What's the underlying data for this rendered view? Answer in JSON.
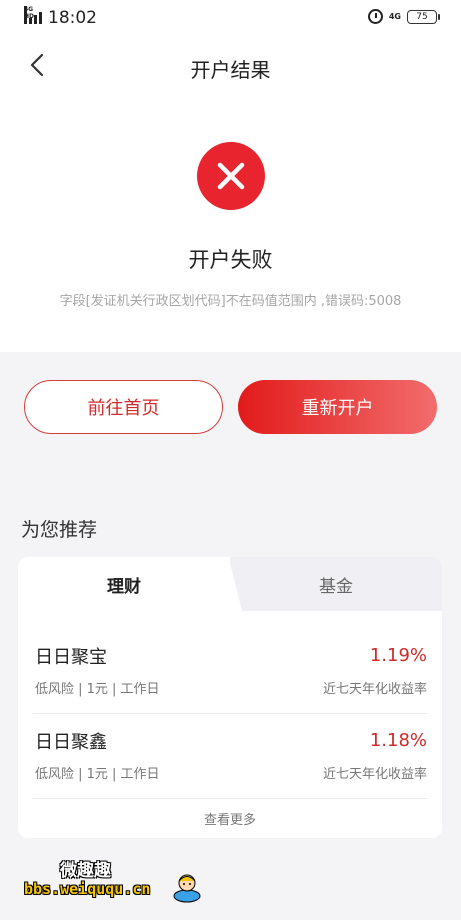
{
  "status_bar": {
    "network_tag": "4G HD",
    "time": "18:02",
    "network_small": "4G",
    "battery": "75"
  },
  "nav": {
    "title": "开户结果"
  },
  "result": {
    "title": "开户失败",
    "error_message": "字段[发证机关行政区划代码]不在码值范围内 ,错误码:5008"
  },
  "actions": {
    "home_label": "前往首页",
    "reopen_label": "重新开户"
  },
  "recommend": {
    "section_title": "为您推荐",
    "tabs": [
      {
        "label": "理财",
        "active": true
      },
      {
        "label": "基金",
        "active": false
      }
    ],
    "items": [
      {
        "name": "日日聚宝",
        "rate": "1.19%",
        "tags": "低风险 | 1元 | 工作日",
        "rate_label": "近七天年化收益率"
      },
      {
        "name": "日日聚鑫",
        "rate": "1.18%",
        "tags": "低风险 | 1元 | 工作日",
        "rate_label": "近七天年化收益率"
      }
    ],
    "more_label": "查看更多"
  },
  "watermark": {
    "title": "微趣趣",
    "url": "bbs.weiququ.cn"
  },
  "colors": {
    "accent": "#e8242e",
    "rate": "#d12a2a",
    "page_bg": "#f4f4f6"
  },
  "icons": [
    "signal-icon",
    "alarm-icon",
    "battery-icon",
    "back-arrow-icon",
    "fail-x-icon"
  ]
}
